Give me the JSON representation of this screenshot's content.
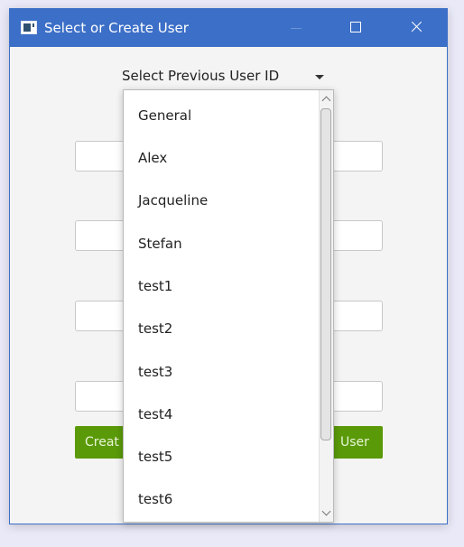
{
  "window": {
    "title": "Select or Create User",
    "icon": "app-window-icon",
    "controls": [
      "minimize-icon",
      "maximize-icon",
      "close-icon"
    ]
  },
  "user_select": {
    "label": "Select Previous User ID",
    "icon": "chevron-down-icon",
    "options": [
      "General",
      "Alex",
      "Jacqueline",
      "Stefan",
      "test1",
      "test2",
      "test3",
      "test4",
      "test5",
      "test6"
    ]
  },
  "buttons": {
    "create_partial": "Creat",
    "user_partial": "User"
  },
  "colors": {
    "titlebar": "#3c6fc7",
    "button_green": "#5a9a09",
    "background": "#f4f4f4"
  }
}
